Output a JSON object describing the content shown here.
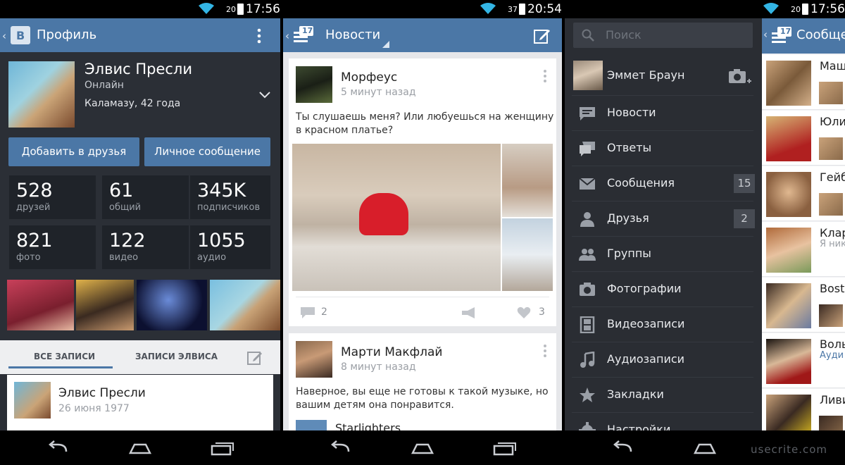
{
  "screen1": {
    "status": {
      "battery": "20",
      "time": "17:56"
    },
    "title": "Профиль",
    "profile": {
      "name": "Элвис Пресли",
      "status": "Онлайн",
      "city": "Каламазу, 42 года"
    },
    "buttons": {
      "add_friend": "Добавить в друзья",
      "message": "Личное сообщение"
    },
    "stats": [
      {
        "num": "528",
        "label": "друзей"
      },
      {
        "num": "61",
        "label": "общий"
      },
      {
        "num": "345K",
        "label": "подписчиков"
      },
      {
        "num": "821",
        "label": "фото"
      },
      {
        "num": "122",
        "label": "видео"
      },
      {
        "num": "1055",
        "label": "аудио"
      }
    ],
    "tabs": {
      "all": "ВСЕ ЗАПИСИ",
      "own": "ЗАПИСИ ЭЛВИСА"
    },
    "post": {
      "author": "Элвис Пресли",
      "date": "26 июня 1977"
    }
  },
  "screen2": {
    "status": {
      "battery": "37",
      "time": "20:54"
    },
    "title": "Новости",
    "badge": "17",
    "post1": {
      "author": "Морфеус",
      "time": "5 минут назад",
      "text1": "Ты слушаешь меня? Или любуешься на женщину",
      "text2": "в красном платье?",
      "comments": "2",
      "likes": "3"
    },
    "post2": {
      "author": "Марти Макфлай",
      "time": "8 минут назад",
      "text1": "Наверное, вы еще не готовы к такой музыке, но",
      "text2": "вашим детям она понравится.",
      "track": "Starlighters"
    }
  },
  "screen3": {
    "status": {
      "battery": "20",
      "time": "17:56"
    },
    "search_placeholder": "Поиск",
    "user": "Эммет Браун",
    "menu": [
      {
        "label": "Новости",
        "icon": "news-icon"
      },
      {
        "label": "Ответы",
        "icon": "replies-icon"
      },
      {
        "label": "Сообщения",
        "icon": "messages-icon",
        "badge": "15"
      },
      {
        "label": "Друзья",
        "icon": "friends-icon",
        "badge": "2"
      },
      {
        "label": "Группы",
        "icon": "groups-icon"
      },
      {
        "label": "Фотографии",
        "icon": "photos-icon"
      },
      {
        "label": "Видеозаписи",
        "icon": "video-icon"
      },
      {
        "label": "Аудиозаписи",
        "icon": "audio-icon"
      },
      {
        "label": "Закладки",
        "icon": "bookmarks-icon"
      },
      {
        "label": "Настройки",
        "icon": "settings-icon"
      }
    ],
    "right_title": "Сообще",
    "right_badge": "17",
    "dialogs": [
      {
        "name": "Маш",
        "sub": ""
      },
      {
        "name": "Юли",
        "sub": ""
      },
      {
        "name": "Гейб",
        "sub": ""
      },
      {
        "name": "Клар",
        "sub": "Я ник"
      },
      {
        "name": "Bost",
        "sub": ""
      },
      {
        "name": "Воль",
        "sub": "Ауди"
      },
      {
        "name": "Ливи",
        "sub": ""
      }
    ]
  },
  "watermark": "usecrite.com"
}
